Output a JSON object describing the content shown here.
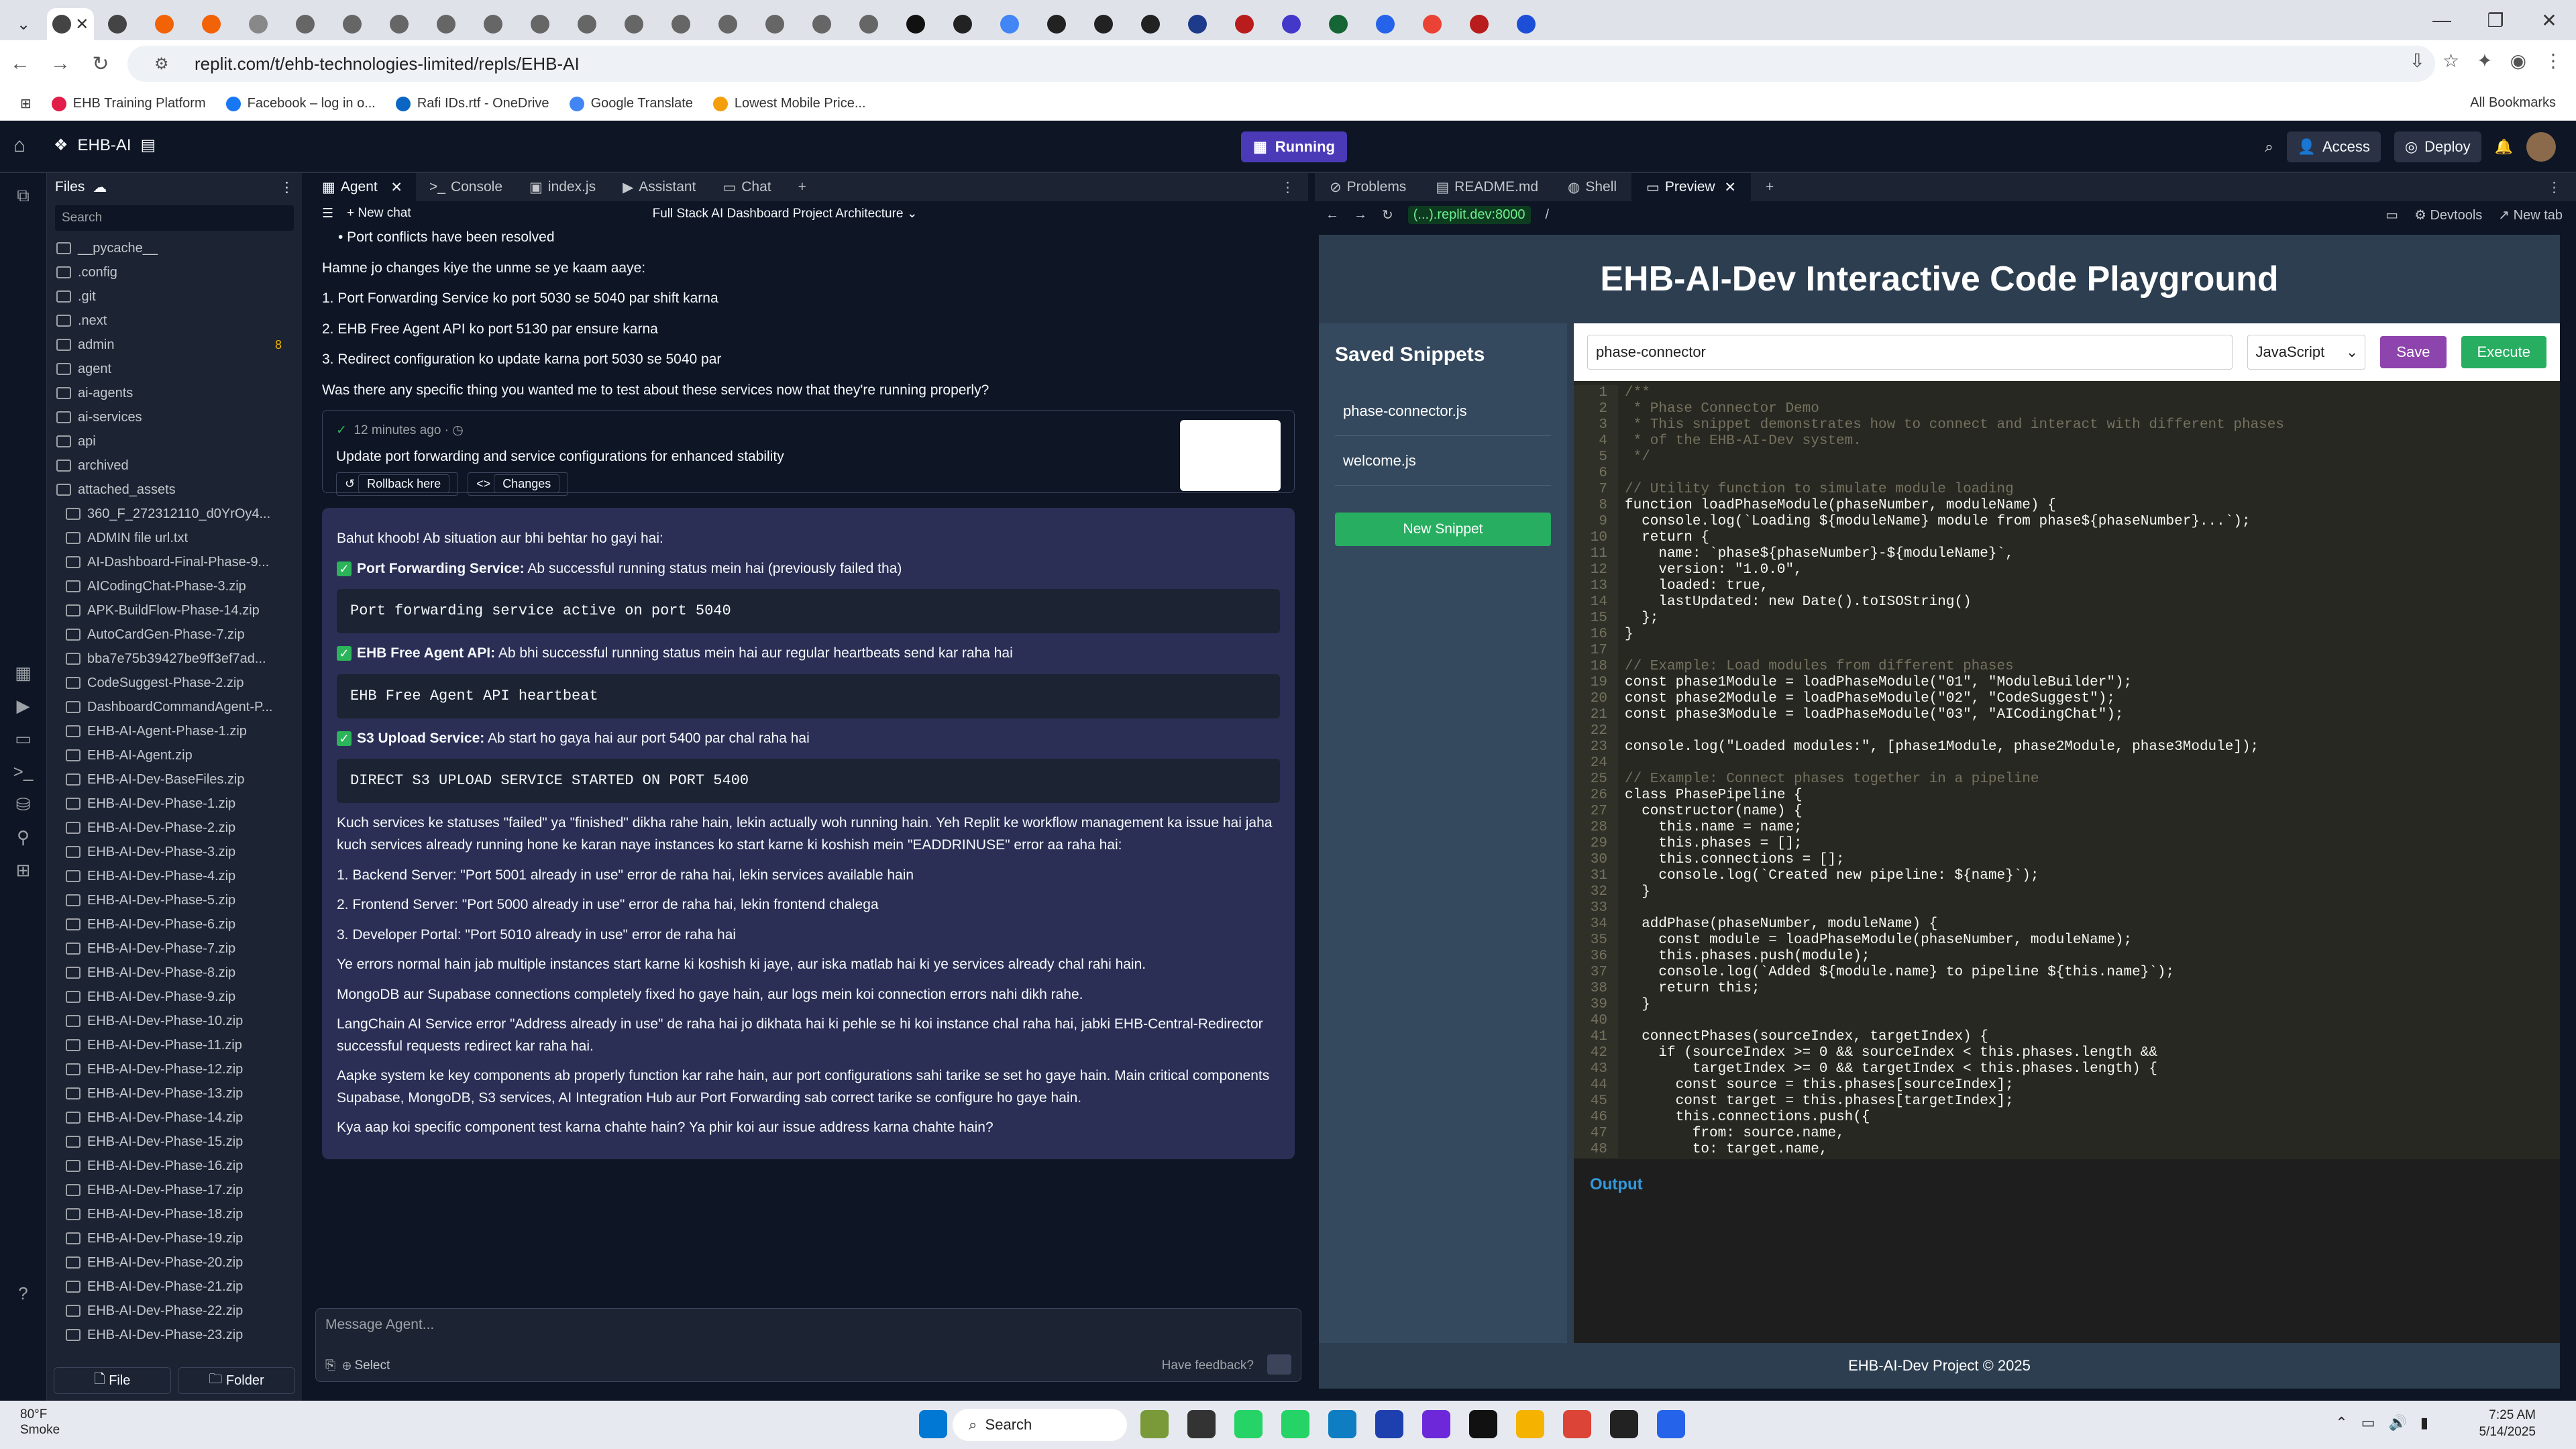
{
  "browser": {
    "url": "replit.com/t/ehb-technologies-limited/repls/EHB-AI",
    "bookmarks": [
      "EHB Training Platform",
      "Facebook – log in o...",
      "Rafi IDs.rtf - OneDrive",
      "Google Translate",
      "Lowest Mobile Price..."
    ],
    "all_bookmarks": "All Bookmarks"
  },
  "header": {
    "project": "EHB-AI",
    "running": "Running",
    "access": "Access",
    "deploy": "Deploy"
  },
  "files": {
    "title": "Files",
    "search_placeholder": "Search",
    "items": [
      {
        "name": "__pycache__",
        "type": "folder"
      },
      {
        "name": ".config",
        "type": "folder"
      },
      {
        "name": ".git",
        "type": "folder"
      },
      {
        "name": ".next",
        "type": "folder"
      },
      {
        "name": "admin",
        "type": "folder",
        "badge": "8"
      },
      {
        "name": "agent",
        "type": "folder"
      },
      {
        "name": "ai-agents",
        "type": "folder"
      },
      {
        "name": "ai-services",
        "type": "folder"
      },
      {
        "name": "api",
        "type": "folder"
      },
      {
        "name": "archived",
        "type": "folder"
      },
      {
        "name": "attached_assets",
        "type": "folder"
      },
      {
        "name": "360_F_272312110_d0YrOy4...",
        "type": "file"
      },
      {
        "name": "ADMIN file url.txt",
        "type": "file"
      },
      {
        "name": "AI-Dashboard-Final-Phase-9...",
        "type": "file"
      },
      {
        "name": "AICodingChat-Phase-3.zip",
        "type": "file"
      },
      {
        "name": "APK-BuildFlow-Phase-14.zip",
        "type": "file"
      },
      {
        "name": "AutoCardGen-Phase-7.zip",
        "type": "file"
      },
      {
        "name": "bba7e75b39427be9ff3ef7ad...",
        "type": "file"
      },
      {
        "name": "CodeSuggest-Phase-2.zip",
        "type": "file"
      },
      {
        "name": "DashboardCommandAgent-P...",
        "type": "file"
      },
      {
        "name": "EHB-AI-Agent-Phase-1.zip",
        "type": "file"
      },
      {
        "name": "EHB-AI-Agent.zip",
        "type": "file"
      },
      {
        "name": "EHB-AI-Dev-BaseFiles.zip",
        "type": "file"
      },
      {
        "name": "EHB-AI-Dev-Phase-1.zip",
        "type": "file"
      },
      {
        "name": "EHB-AI-Dev-Phase-2.zip",
        "type": "file"
      },
      {
        "name": "EHB-AI-Dev-Phase-3.zip",
        "type": "file"
      },
      {
        "name": "EHB-AI-Dev-Phase-4.zip",
        "type": "file"
      },
      {
        "name": "EHB-AI-Dev-Phase-5.zip",
        "type": "file"
      },
      {
        "name": "EHB-AI-Dev-Phase-6.zip",
        "type": "file"
      },
      {
        "name": "EHB-AI-Dev-Phase-7.zip",
        "type": "file"
      },
      {
        "name": "EHB-AI-Dev-Phase-8.zip",
        "type": "file"
      },
      {
        "name": "EHB-AI-Dev-Phase-9.zip",
        "type": "file"
      },
      {
        "name": "EHB-AI-Dev-Phase-10.zip",
        "type": "file"
      },
      {
        "name": "EHB-AI-Dev-Phase-11.zip",
        "type": "file"
      },
      {
        "name": "EHB-AI-Dev-Phase-12.zip",
        "type": "file"
      },
      {
        "name": "EHB-AI-Dev-Phase-13.zip",
        "type": "file"
      },
      {
        "name": "EHB-AI-Dev-Phase-14.zip",
        "type": "file"
      },
      {
        "name": "EHB-AI-Dev-Phase-15.zip",
        "type": "file"
      },
      {
        "name": "EHB-AI-Dev-Phase-16.zip",
        "type": "file"
      },
      {
        "name": "EHB-AI-Dev-Phase-17.zip",
        "type": "file"
      },
      {
        "name": "EHB-AI-Dev-Phase-18.zip",
        "type": "file"
      },
      {
        "name": "EHB-AI-Dev-Phase-19.zip",
        "type": "file"
      },
      {
        "name": "EHB-AI-Dev-Phase-20.zip",
        "type": "file"
      },
      {
        "name": "EHB-AI-Dev-Phase-21.zip",
        "type": "file"
      },
      {
        "name": "EHB-AI-Dev-Phase-22.zip",
        "type": "file"
      },
      {
        "name": "EHB-AI-Dev-Phase-23.zip",
        "type": "file"
      }
    ],
    "file_btn": "File",
    "folder_btn": "Folder"
  },
  "agent": {
    "tabs": [
      "Agent",
      "Console",
      "index.js",
      "Assistant",
      "Chat"
    ],
    "new_chat": "New chat",
    "chat_title": "Full Stack AI Dashboard Project Architecture",
    "pre_lines": [
      "• Port conflicts have been resolved",
      "Hamne jo changes kiye the unme se ye kaam aaye:",
      "1. Port Forwarding Service ko port 5030 se 5040 par shift karna",
      "2. EHB Free Agent API ko port 5130 par ensure karna",
      "3. Redirect configuration ko update karna port 5030 se 5040 par",
      "Was there any specific thing you wanted me to test about these services now that they're running properly?"
    ],
    "checkpoint": {
      "time": "12 minutes ago",
      "message": "Update port forwarding and service configurations for enhanced stability",
      "rollback": "Rollback here",
      "changes": "Changes"
    },
    "reply": {
      "intro": "Bahut khoob! Ab situation aur bhi behtar ho gayi hai:",
      "s1_title": "Port Forwarding Service:",
      "s1_text": "Ab successful running status mein hai (previously failed tha)",
      "s1_code": "Port forwarding service active on port 5040",
      "s2_title": "EHB Free Agent API:",
      "s2_text": "Ab bhi successful running status mein hai aur regular heartbeats send kar raha hai",
      "s2_code": "EHB Free Agent API heartbeat",
      "s3_title": "S3 Upload Service:",
      "s3_text": "Ab start ho gaya hai aur port 5400 par chal raha hai",
      "s3_code": "DIRECT S3 UPLOAD SERVICE STARTED ON PORT 5400",
      "p1": "Kuch services ke statuses \"failed\" ya \"finished\" dikha rahe hain, lekin actually woh running hain. Yeh Replit ke workflow management ka issue hai jaha kuch services already running hone ke karan naye instances ko start karne ki koshish mein \"EADDRINUSE\" error aa raha hai:",
      "l1": "1. Backend Server: \"Port 5001 already in use\" error de raha hai, lekin services available hain",
      "l2": "2. Frontend Server: \"Port 5000 already in use\" error de raha hai, lekin frontend chalega",
      "l3": "3. Developer Portal: \"Port 5010 already in use\" error de raha hai",
      "p2": "Ye errors normal hain jab multiple instances start karne ki koshish ki jaye, aur iska matlab hai ki ye services already chal rahi hain.",
      "p3": "MongoDB aur Supabase connections completely fixed ho gaye hain, aur logs mein koi connection errors nahi dikh rahe.",
      "p4": "LangChain AI Service error \"Address already in use\" de raha hai jo dikhata hai ki pehle se hi koi instance chal raha hai, jabki EHB-Central-Redirector successful requests redirect kar raha hai.",
      "p5": "Aapke system ke key components ab properly function kar rahe hain, aur port configurations sahi tarike se set ho gaye hain. Main critical components Supabase, MongoDB, S3 services, AI Integration Hub aur Port Forwarding sab correct tarike se configure ho gaye hain.",
      "p6": "Kya aap koi specific component test karna chahte hain? Ya phir koi aur issue address karna chahte hain?"
    },
    "input_placeholder": "Message Agent...",
    "select": "Select",
    "feedback": "Have feedback?"
  },
  "preview": {
    "tabs": [
      "Problems",
      "README.md",
      "Shell",
      "Preview"
    ],
    "domain": "(...).replit.dev:8000",
    "path": "/",
    "devtools": "Devtools",
    "new_tab": "New tab",
    "app_title": "EHB-AI-Dev Interactive Code Playground",
    "saved_snippets": "Saved Snippets",
    "snippets": [
      "phase-connector.js",
      "welcome.js"
    ],
    "new_snippet": "New Snippet",
    "snippet_name": "phase-connector",
    "language": "JavaScript",
    "save": "Save",
    "execute": "Execute",
    "output": "Output",
    "footer": "EHB-AI-Dev Project © 2025",
    "code": [
      "/**",
      " * Phase Connector Demo",
      " * This snippet demonstrates how to connect and interact with different phases",
      " * of the EHB-AI-Dev system.",
      " */",
      "",
      "// Utility function to simulate module loading",
      "function loadPhaseModule(phaseNumber, moduleName) {",
      "  console.log(`Loading ${moduleName} module from phase${phaseNumber}...`);",
      "  return {",
      "    name: `phase${phaseNumber}-${moduleName}`,",
      "    version: \"1.0.0\",",
      "    loaded: true,",
      "    lastUpdated: new Date().toISOString()",
      "  };",
      "}",
      "",
      "// Example: Load modules from different phases",
      "const phase1Module = loadPhaseModule(\"01\", \"ModuleBuilder\");",
      "const phase2Module = loadPhaseModule(\"02\", \"CodeSuggest\");",
      "const phase3Module = loadPhaseModule(\"03\", \"AICodingChat\");",
      "",
      "console.log(\"Loaded modules:\", [phase1Module, phase2Module, phase3Module]);",
      "",
      "// Example: Connect phases together in a pipeline",
      "class PhasePipeline {",
      "  constructor(name) {",
      "    this.name = name;",
      "    this.phases = [];",
      "    this.connections = [];",
      "    console.log(`Created new pipeline: ${name}`);",
      "  }",
      "",
      "  addPhase(phaseNumber, moduleName) {",
      "    const module = loadPhaseModule(phaseNumber, moduleName);",
      "    this.phases.push(module);",
      "    console.log(`Added ${module.name} to pipeline ${this.name}`);",
      "    return this;",
      "  }",
      "",
      "  connectPhases(sourceIndex, targetIndex) {",
      "    if (sourceIndex >= 0 && sourceIndex < this.phases.length &&",
      "        targetIndex >= 0 && targetIndex < this.phases.length) {",
      "      const source = this.phases[sourceIndex];",
      "      const target = this.phases[targetIndex];",
      "      this.connections.push({",
      "        from: source.name,",
      "        to: target.name,"
    ]
  },
  "taskbar": {
    "weather_temp": "80°F",
    "weather_desc": "Smoke",
    "search": "Search",
    "time": "7:25 AM",
    "date": "5/14/2025"
  }
}
